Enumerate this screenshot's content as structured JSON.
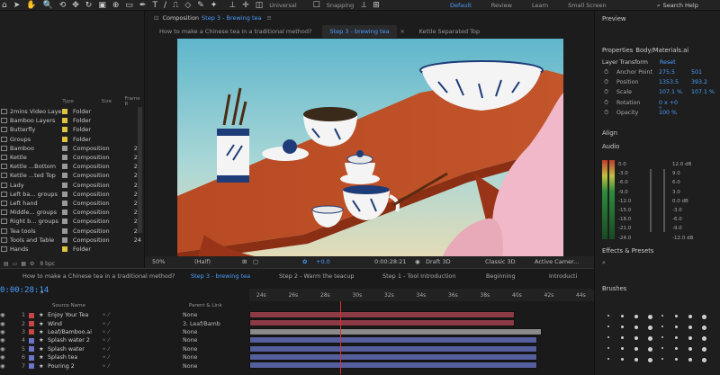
{
  "toolbar": {
    "labels": {
      "universal": "Universal",
      "snapping": "Snapping"
    },
    "workspaces": [
      "Default",
      "Review",
      "Learn",
      "Small Screen"
    ],
    "active_workspace": "Default",
    "search_placeholder": "Search Help"
  },
  "project": {
    "columns": {
      "type": "Type",
      "size": "Size",
      "frame": "Frame R"
    },
    "items": [
      {
        "name": "2mins Video Layers",
        "type": "Folder",
        "size": "",
        "label_color": "#e0c341"
      },
      {
        "name": "Bamboo Layers",
        "type": "Folder",
        "size": "",
        "label_color": "#e0c341"
      },
      {
        "name": "Butterfly",
        "type": "Folder",
        "size": "",
        "label_color": "#e0c341"
      },
      {
        "name": "Groups",
        "type": "Folder",
        "size": "",
        "label_color": "#e0c341"
      },
      {
        "name": "Bamboo",
        "type": "Composition",
        "size": "24",
        "label_color": "#9a9a9a"
      },
      {
        "name": "Kettle",
        "type": "Composition",
        "size": "24",
        "label_color": "#9a9a9a"
      },
      {
        "name": "Kettle ...Bottom",
        "type": "Composition",
        "size": "24",
        "label_color": "#9a9a9a"
      },
      {
        "name": "Kettle ...ted Top",
        "type": "Composition",
        "size": "24",
        "label_color": "#9a9a9a"
      },
      {
        "name": "Lady",
        "type": "Composition",
        "size": "24",
        "label_color": "#9a9a9a"
      },
      {
        "name": "Left ba... groups",
        "type": "Composition",
        "size": "24",
        "label_color": "#9a9a9a"
      },
      {
        "name": "Left hand",
        "type": "Composition",
        "size": "24",
        "label_color": "#9a9a9a"
      },
      {
        "name": "Middle... groups",
        "type": "Composition",
        "size": "24",
        "label_color": "#9a9a9a"
      },
      {
        "name": "Right b... groups",
        "type": "Composition",
        "size": "24",
        "label_color": "#9a9a9a"
      },
      {
        "name": "Tea tools",
        "type": "Composition",
        "size": "24",
        "label_color": "#9a9a9a"
      },
      {
        "name": "Tools and Table",
        "type": "Composition",
        "size": "24",
        "label_color": "#9a9a9a"
      },
      {
        "name": "Hands",
        "type": "Folder",
        "size": "",
        "label_color": "#e0c341"
      }
    ],
    "footer": "8 bpc"
  },
  "viewer": {
    "panel_label": "Composition",
    "comp_name": "Step 3 - Brewing tea",
    "tabs": [
      "How to make a Chinese tea in a traditional method?",
      "Step 3 - brewing tea",
      "Kettle Separated Top"
    ],
    "active_tab": 1,
    "bottom_bar": {
      "zoom": "50%",
      "resolution": "(Half)",
      "exposure": "+0.0",
      "time": "0:00:28:21",
      "renderer": "Draft 3D",
      "mode": "Classic 3D",
      "camera": "Active Camer..."
    }
  },
  "properties": {
    "header": "Preview",
    "title": "Properties",
    "layer": "Body/Materials.ai",
    "section": "Layer Transform",
    "reset": "Reset",
    "rows": [
      {
        "name": "Anchor Point",
        "v1": "275.5",
        "v2": "501"
      },
      {
        "name": "Position",
        "v1": "1353.5",
        "v2": "393.2"
      },
      {
        "name": "Scale",
        "v1": "107.1 %",
        "v2": "107.1 %"
      },
      {
        "name": "Rotation",
        "v1": "0 x +0 °",
        "v2": ""
      },
      {
        "name": "Opacity",
        "v1": "100 %",
        "v2": ""
      }
    ],
    "align": "Align",
    "audio": "Audio",
    "audio_left": [
      "0.0",
      "-3.0",
      "-6.0",
      "-9.0",
      "-12.0",
      "-15.0",
      "-18.0",
      "-21.0",
      "-24.0"
    ],
    "audio_right": [
      "12.0 dB",
      "9.0",
      "6.0",
      "3.0",
      "0.0 dB",
      "-3.0",
      "-6.0",
      "-9.0",
      "-12.0 dB"
    ],
    "effects": "Effects & Presets",
    "brushes": "Brushes"
  },
  "timeline": {
    "timecode": "0:00:28:14",
    "tabs": [
      "How to make a Chinese tea in a traditional method?",
      "Step 3 - brewing tea",
      "Step 2 - Warm the teacup",
      "Step 1 - Tool Introduction",
      "Beginning",
      "Introducti"
    ],
    "active_tab": 1,
    "ruler": [
      "24s",
      "26s",
      "28s",
      "30s",
      "32s",
      "34s",
      "36s",
      "38s",
      "40s",
      "42s",
      "44s"
    ],
    "headers": {
      "source": "Source Name",
      "parent": "Parent & Link"
    },
    "layers": [
      {
        "num": "1",
        "name": "Enjoy Your Tea",
        "label_color": "#c74545",
        "parent": "None",
        "bar_color": "#8b3a46"
      },
      {
        "num": "2",
        "name": "Wind",
        "label_color": "#c74545",
        "parent": "3. Leaf/Bamb",
        "bar_color": "#8b3a46"
      },
      {
        "num": "3",
        "name": "Leaf/Bamboo.ai",
        "label_color": "#c74545",
        "parent": "None",
        "bar_color": "#8a8a8a"
      },
      {
        "num": "4",
        "name": "Splash water 2",
        "label_color": "#6b74c9",
        "parent": "None",
        "bar_color": "#555f9e"
      },
      {
        "num": "5",
        "name": "Splash water",
        "label_color": "#6b74c9",
        "parent": "None",
        "bar_color": "#555f9e"
      },
      {
        "num": "6",
        "name": "Splash tea",
        "label_color": "#6b74c9",
        "parent": "None",
        "bar_color": "#555f9e"
      },
      {
        "num": "7",
        "name": "Pouring 2",
        "label_color": "#6b74c9",
        "parent": "None",
        "bar_color": "#555f9e"
      }
    ]
  }
}
